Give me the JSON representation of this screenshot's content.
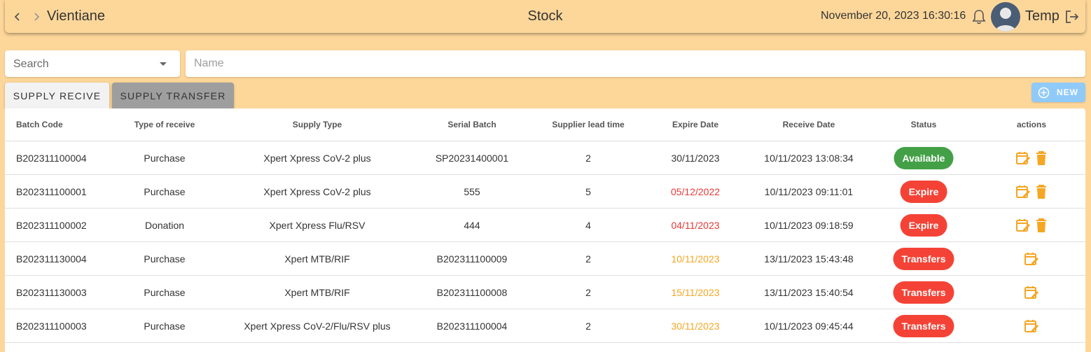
{
  "header": {
    "location": "Vientiane",
    "title": "Stock",
    "datetime": "November 20, 2023 16:30:16",
    "username": "Temp"
  },
  "filters": {
    "search_select_value": "Search",
    "name_placeholder": "Name"
  },
  "tabs": [
    {
      "label": "SUPPLY RECIVE",
      "active": true
    },
    {
      "label": "SUPPLY TRANSFER",
      "active": false
    }
  ],
  "new_button_label": "NEW",
  "table": {
    "columns": [
      "Batch Code",
      "Type of receive",
      "Supply Type",
      "Serial Batch",
      "Supplier lead time",
      "Expire Date",
      "Receive Date",
      "Status",
      "actions"
    ],
    "rows": [
      {
        "batch_code": "B202311100004",
        "type": "Purchase",
        "supply_type": "Xpert Xpress CoV-2 plus",
        "serial": "SP20231400001",
        "lead_time": "2",
        "expire": "30/11/2023",
        "receive": "10/11/2023 13:08:34",
        "status": "Available"
      },
      {
        "batch_code": "B202311100001",
        "type": "Purchase",
        "supply_type": "Xpert Xpress CoV-2 plus",
        "serial": "555",
        "lead_time": "5",
        "expire": "05/12/2022",
        "receive": "10/11/2023 09:11:01",
        "status": "Expire"
      },
      {
        "batch_code": "B202311100002",
        "type": "Donation",
        "supply_type": "Xpert Xpress Flu/RSV",
        "serial": "444",
        "lead_time": "4",
        "expire": "04/11/2023",
        "receive": "10/11/2023 09:18:59",
        "status": "Expire"
      },
      {
        "batch_code": "B202311130004",
        "type": "Purchase",
        "supply_type": "Xpert MTB/RIF",
        "serial": "B202311100009",
        "lead_time": "2",
        "expire": "10/11/2023",
        "receive": "13/11/2023 15:43:48",
        "status": "Transfers"
      },
      {
        "batch_code": "B202311130003",
        "type": "Purchase",
        "supply_type": "Xpert MTB/RIF",
        "serial": "B202311100008",
        "lead_time": "2",
        "expire": "15/11/2023",
        "receive": "13/11/2023 15:40:54",
        "status": "Transfers"
      },
      {
        "batch_code": "B202311100003",
        "type": "Purchase",
        "supply_type": "Xpert Xpress CoV-2/Flu/RSV plus",
        "serial": "B202311100004",
        "lead_time": "2",
        "expire": "30/11/2023",
        "receive": "10/11/2023 09:45:44",
        "status": "Transfers"
      }
    ]
  },
  "colors": {
    "background": "#fdd79a",
    "status_available": "#43a047",
    "status_red": "#f44336",
    "expire_red": "#e53935",
    "expire_orange": "#f5a623",
    "action_icon": "#f5a623",
    "new_button": "#90caf9"
  },
  "icons": {
    "nav_back": "chevron-left-icon",
    "nav_forward": "chevron-right-icon",
    "notifications": "bell-icon",
    "avatar": "user-avatar",
    "logout": "logout-icon",
    "new": "plus-circle-icon",
    "edit": "calendar-edit-icon",
    "delete": "trash-icon"
  }
}
